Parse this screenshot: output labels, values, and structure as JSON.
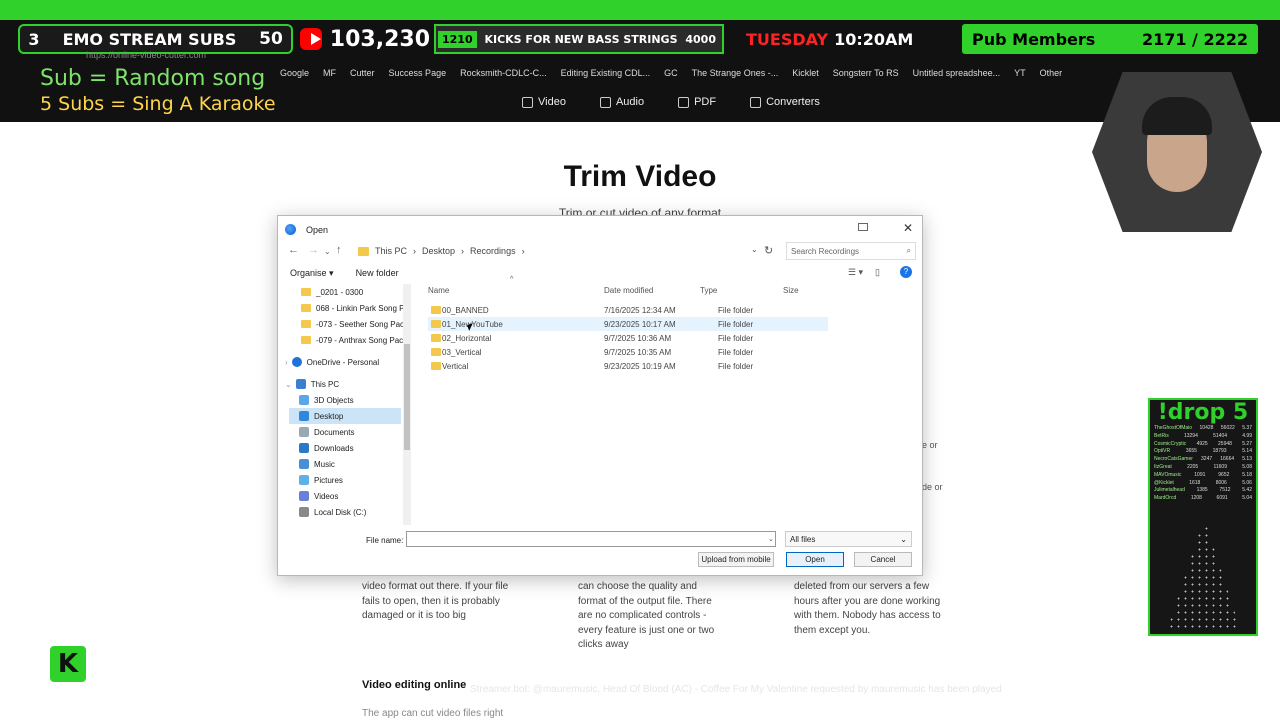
{
  "overlay": {
    "subs_number": "3",
    "subs_label": "EMO STREAM SUBS",
    "subs_count": "50",
    "youtube_count": "103,230",
    "kick_goal_amount": "1210",
    "kick_goal_text": "KICKS FOR NEW BASS STRINGS",
    "kick_goal_target": "4000",
    "day": "TUESDAY",
    "time": "10:20AM",
    "members_label": "Pub Members",
    "members_count": "2171 / 2222",
    "rule1": "Sub = Random song",
    "rule2": "5 Subs = Sing A Karaoke",
    "url": "https://online-video-cutter.com",
    "bookmarks": [
      "Google",
      "MF",
      "Cutter",
      "Success Page",
      "Rocksmith-CDLC-C...",
      "Editing Existing CDL...",
      "GC",
      "The Strange Ones -...",
      "Kicklet",
      "Songsterr To RS",
      "Untitled spreadshee...",
      "YT"
    ],
    "bookmarks_other": "Other",
    "ticker": "Streamer.bot: @mauremusic, Head Of Blood (AC) - Coffee For My Valentine requested by mauremusic has been played"
  },
  "site_nav": {
    "video": "Video",
    "audio": "Audio",
    "pdf": "PDF",
    "converters": "Converters"
  },
  "page": {
    "title": "Trim Video",
    "subtitle": "Trim or cut video of any format",
    "feature1": "video format out there. If your file fails to open, then it is probably damaged or it is too big",
    "feature2": "can choose the quality and format of the output file. There are no complicated controls - every feature is just one or two clicks away",
    "feature3": "deleted from our servers a few hours after you are done working with them. Nobody has access to them except you.",
    "section_title": "Video editing online",
    "section_text": "The app can cut video files right",
    "side_frag1": "e or",
    "side_frag2": "de or"
  },
  "drop": {
    "title": "!drop 5",
    "rows": [
      {
        "name": "TheGhostOfMaio",
        "a": "10428",
        "b": "56022",
        "c": "5.37"
      },
      {
        "name": "BetRis",
        "a": "13294",
        "b": "51404",
        "c": "4.99"
      },
      {
        "name": "CosmicCryptic",
        "a": "4925",
        "b": "25948",
        "c": "5.27"
      },
      {
        "name": "OptiVR",
        "a": "3655",
        "b": "18793",
        "c": "5.14"
      },
      {
        "name": "NecroCatsGamer",
        "a": "3247",
        "b": "16664",
        "c": "5.13"
      },
      {
        "name": "ItzGreat",
        "a": "2205",
        "b": "11609",
        "c": "5.08"
      },
      {
        "name": "MAVOmusic",
        "a": "1091",
        "b": "9652",
        "c": "5.18"
      },
      {
        "name": "@Kicklet",
        "a": "1618",
        "b": "8006",
        "c": "5.06"
      },
      {
        "name": "Julimetalhead",
        "a": "1385",
        "b": "7512",
        "c": "5.42"
      },
      {
        "name": "MardOrcd",
        "a": "1208",
        "b": "6091",
        "c": "5.04"
      }
    ]
  },
  "dialog": {
    "title": "Open",
    "breadcrumb": [
      "This PC",
      "Desktop",
      "Recordings"
    ],
    "search_placeholder": "Search Recordings",
    "organise": "Organise",
    "new_folder": "New folder",
    "nav_items": [
      "_0201 - 0300",
      "068 - Linkin Park Song Pa",
      "-073 - Seether Song Pack",
      "-079 - Anthrax Song Pack",
      "OneDrive - Personal",
      "This PC",
      "3D Objects",
      "Desktop",
      "Documents",
      "Downloads",
      "Music",
      "Pictures",
      "Videos",
      "Local Disk (C:)"
    ],
    "columns": {
      "name": "Name",
      "date": "Date modified",
      "type": "Type",
      "size": "Size"
    },
    "files": [
      {
        "name": "00_BANNED",
        "date": "7/16/2025 12:34 AM",
        "type": "File folder"
      },
      {
        "name": "01_NewYouTube",
        "date": "9/23/2025 10:17 AM",
        "type": "File folder"
      },
      {
        "name": "02_Horizontal",
        "date": "9/7/2025 10:36 AM",
        "type": "File folder"
      },
      {
        "name": "03_Vertical",
        "date": "9/7/2025 10:35 AM",
        "type": "File folder"
      },
      {
        "name": "Vertical",
        "date": "9/23/2025 10:19 AM",
        "type": "File folder"
      }
    ],
    "file_name_label": "File name:",
    "file_name_value": "",
    "type_filter": "All files",
    "upload_label": "Upload from mobile",
    "open_label": "Open",
    "cancel_label": "Cancel"
  }
}
